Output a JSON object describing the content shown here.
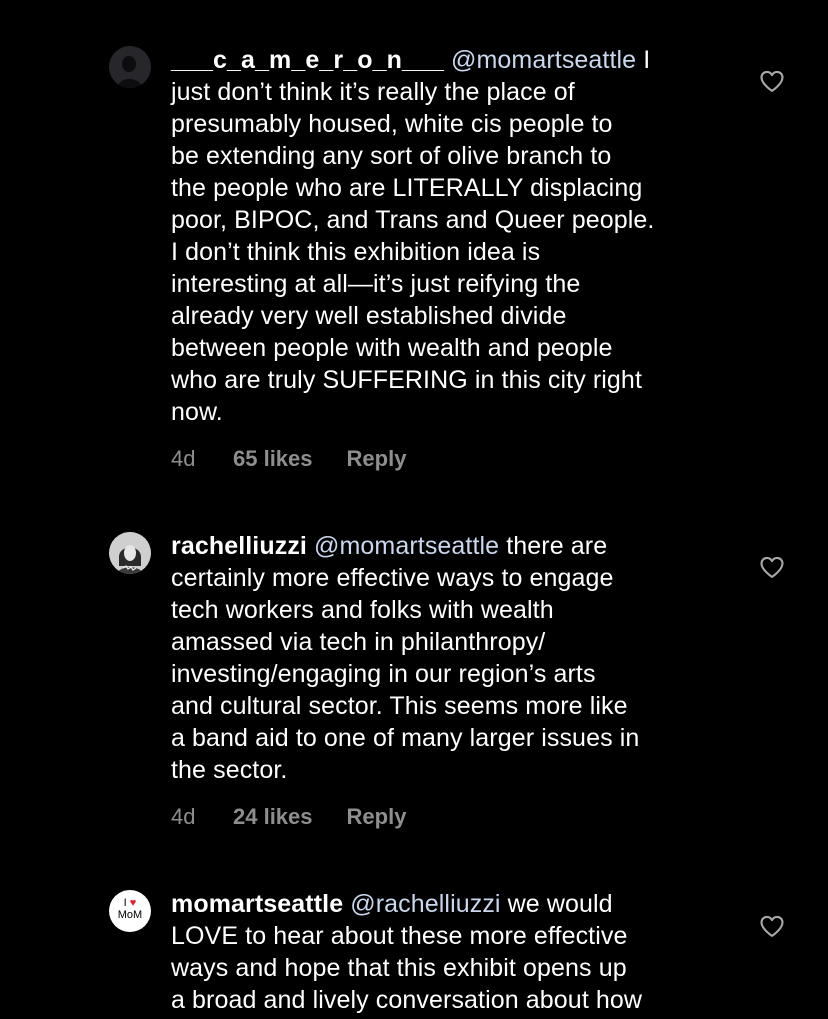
{
  "comments": [
    {
      "username": "___c_a_m_e_r_o_n___",
      "mention": "@momartseattle",
      "body_lines": [
        " I",
        "just don’t think it’s really the place of",
        "presumably housed, white cis people to",
        "be extending any sort of olive branch to",
        "the people who are LITERALLY displacing",
        "poor, BIPOC, and Trans and Queer people.",
        "I don’t think this exhibition idea is",
        "interesting at all—it’s just reifying the",
        "already very well established divide",
        "between people with wealth and people",
        "who are truly SUFFERING in this city right",
        "now."
      ],
      "time": "4d",
      "likes": "65 likes",
      "reply": "Reply",
      "avatar_icon": "profile-photo-icon",
      "like_icon": "heart-outline-icon"
    },
    {
      "username": "rachelliuzzi",
      "mention": "@momartseattle",
      "body_lines": [
        " there are",
        "certainly more effective ways to engage",
        "tech workers and folks with wealth",
        "amassed via tech in philanthropy/",
        "investing/engaging in our region’s arts",
        "and cultural sector. This seems more like",
        "a band aid to one of many larger issues in",
        "the sector."
      ],
      "time": "4d",
      "likes": "24 likes",
      "reply": "Reply",
      "avatar_icon": "profile-photo-icon",
      "like_icon": "heart-outline-icon"
    },
    {
      "username": "momartseattle",
      "mention": "@rachelliuzzi",
      "body_lines": [
        " we would",
        "LOVE to hear about these more effective",
        "ways and hope that this exhibit opens up",
        "a broad and lively conversation about how"
      ],
      "avatar_logo_top": "I ♥",
      "avatar_logo_bottom": "MoM",
      "avatar_icon": "mom-logo-icon",
      "like_icon": "heart-outline-icon"
    }
  ],
  "colors": {
    "background": "#000000",
    "text": "#ffffff",
    "mention": "#c9d8ee",
    "meta": "#8e8e8e",
    "logo_heart": "#e0202a"
  }
}
